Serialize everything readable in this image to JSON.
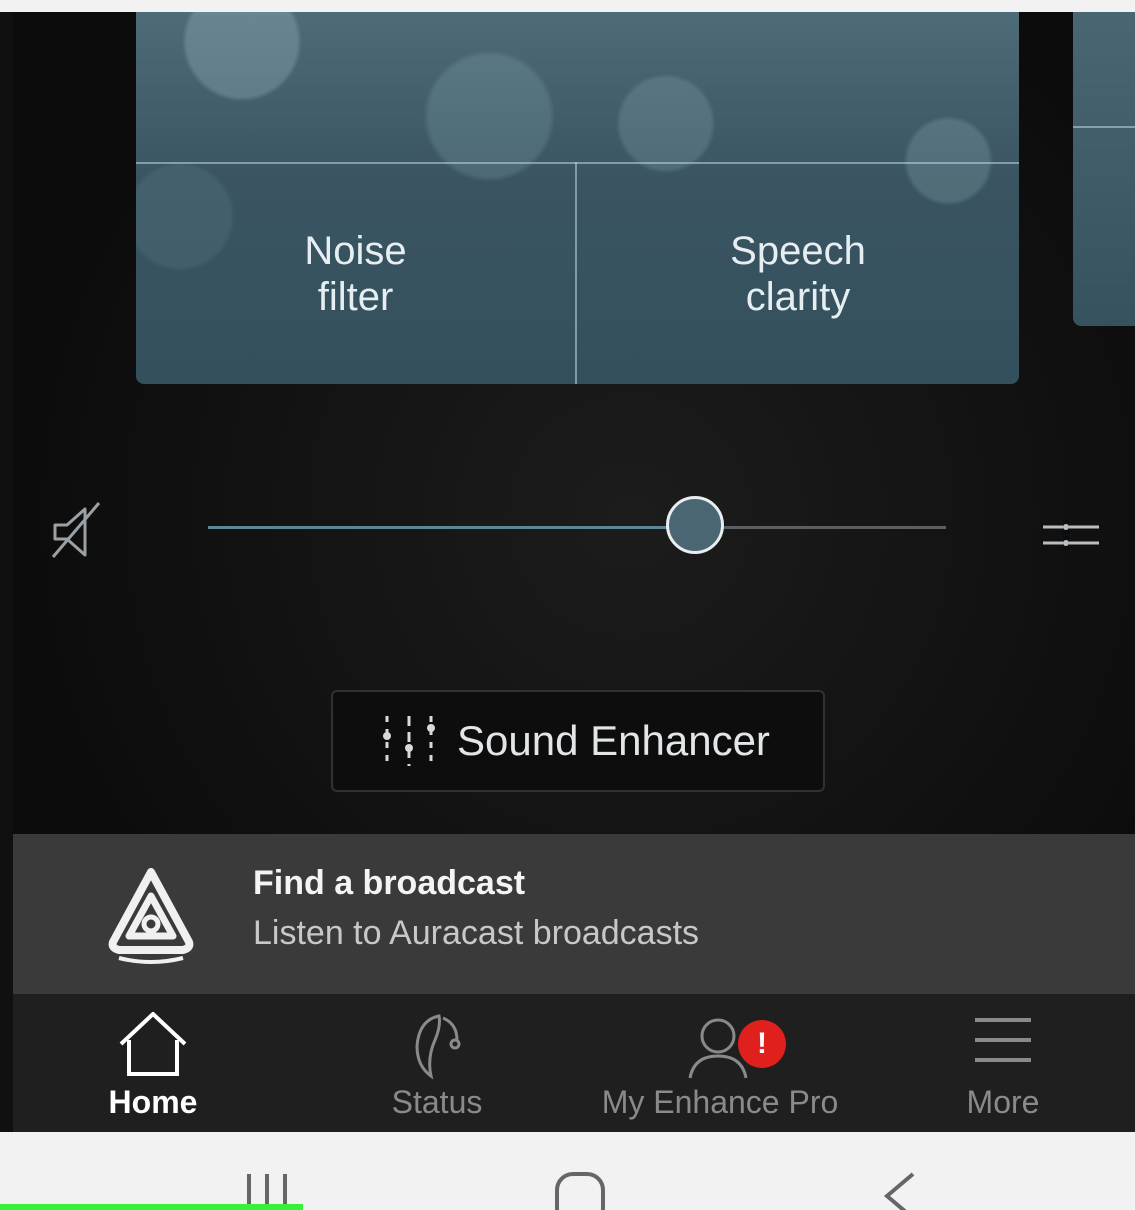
{
  "program_tiles": [
    {
      "label_line1": "Noise",
      "label_line2": "filter"
    },
    {
      "label_line1": "Speech",
      "label_line2": "clarity"
    }
  ],
  "volume": {
    "level": 0.66
  },
  "sound_enhancer": {
    "label": "Sound Enhancer"
  },
  "broadcast": {
    "title": "Find a broadcast",
    "subtitle": "Listen to Auracast broadcasts"
  },
  "tabs": [
    {
      "label": "Home",
      "icon": "home-icon",
      "active": true
    },
    {
      "label": "Status",
      "icon": "hearing-aid-icon",
      "active": false
    },
    {
      "label": "My Enhance Pro",
      "icon": "person-icon",
      "active": false,
      "badge": "!"
    },
    {
      "label": "More",
      "icon": "menu-icon",
      "active": false
    }
  ],
  "colors": {
    "accent": "#4a6672",
    "badge": "#e0201c"
  }
}
